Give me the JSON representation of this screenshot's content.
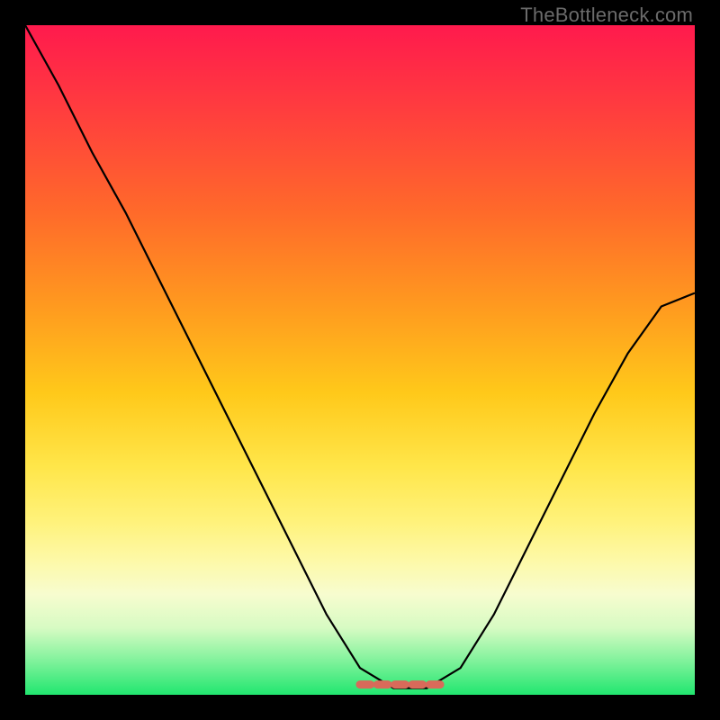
{
  "watermark": "TheBottleneck.com",
  "colors": {
    "frame": "#000000",
    "gradient_top": "#ff1a4d",
    "gradient_mid": "#ffe64a",
    "gradient_bottom": "#21e66f",
    "curve": "#000000",
    "floor_marker": "#d96a5a"
  },
  "chart_data": {
    "type": "line",
    "title": "",
    "xlabel": "",
    "ylabel": "",
    "xlim": [
      0,
      1
    ],
    "ylim": [
      0,
      1
    ],
    "series": [
      {
        "name": "bottleneck-curve",
        "x": [
          0.0,
          0.05,
          0.1,
          0.15,
          0.2,
          0.25,
          0.3,
          0.35,
          0.4,
          0.45,
          0.5,
          0.55,
          0.6,
          0.65,
          0.7,
          0.75,
          0.8,
          0.85,
          0.9,
          0.95,
          1.0
        ],
        "y": [
          1.0,
          0.91,
          0.81,
          0.72,
          0.62,
          0.52,
          0.42,
          0.32,
          0.22,
          0.12,
          0.04,
          0.01,
          0.01,
          0.04,
          0.12,
          0.22,
          0.32,
          0.42,
          0.51,
          0.58,
          0.6
        ]
      }
    ],
    "annotations": [
      {
        "name": "floor-marker",
        "x_range": [
          0.5,
          0.63
        ],
        "y": 0.01
      }
    ]
  }
}
